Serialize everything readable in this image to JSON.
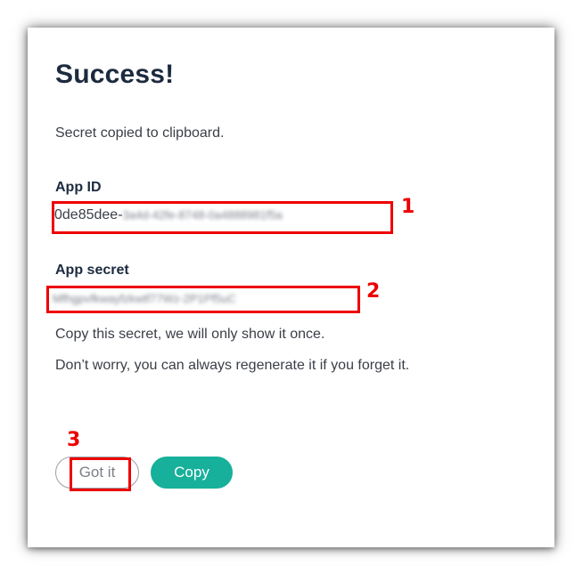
{
  "dialog": {
    "title": "Success!",
    "message": "Secret copied to clipboard.",
    "app_id_label": "App ID",
    "app_id_value_visible": "0de85dee-",
    "app_id_value_obscured": "3a4d-42fe-8748-0a4888981f5a",
    "app_secret_label": "App secret",
    "app_secret_value_obscured": "Mfhgpvfkwayfzkwtf77Wz-2P1Pf5uC",
    "note_once": "Copy this secret, we will only show it once.",
    "note_regenerate": "Don’t worry, you can always regenerate it if you forget it.",
    "got_it_label": "Got it",
    "copy_label": "Copy"
  },
  "annotations": {
    "marker_1": "1",
    "marker_2": "2",
    "marker_3": "3"
  },
  "colors": {
    "accent": "#17b09a",
    "title": "#1c2b3f",
    "highlight": "#ee0000"
  }
}
